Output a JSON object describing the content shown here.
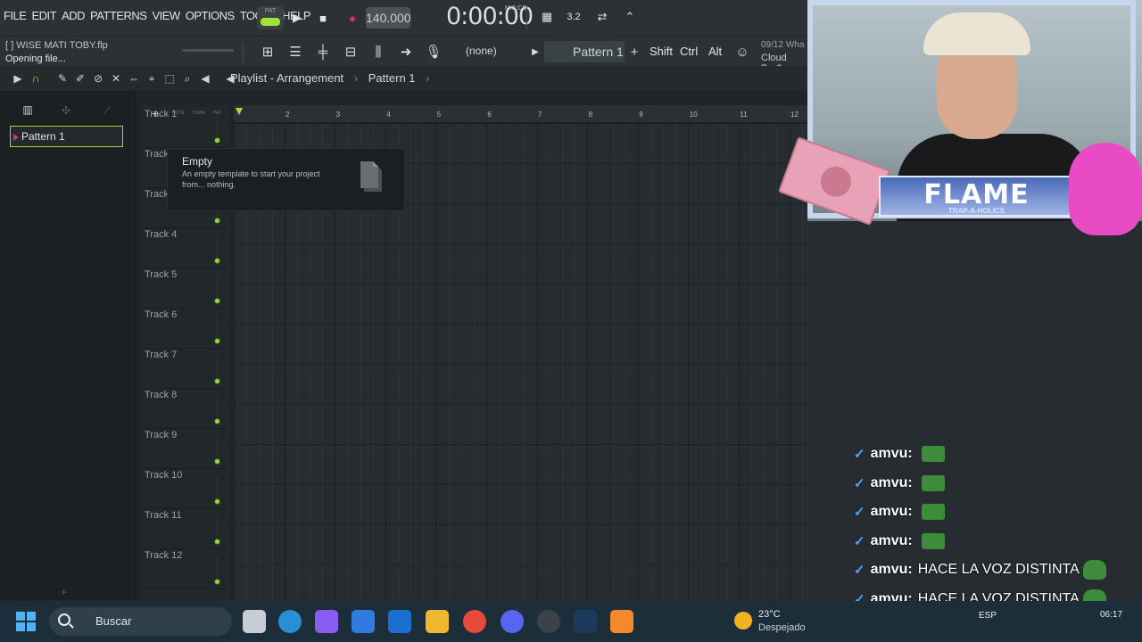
{
  "menu": [
    "FILE",
    "EDIT",
    "ADD",
    "PATTERNS",
    "VIEW",
    "OPTIONS",
    "TOOLS",
    "HELP"
  ],
  "transport": {
    "mode_label": "PAT",
    "tempo": "140.000",
    "time": "0:00:00",
    "time_unit": "M:S:CS"
  },
  "project": {
    "filename": "[ ] WISE MATI TOBY.flp",
    "status": "Opening file..."
  },
  "toolbar2": {
    "input_select": "(none)",
    "pattern_select": "Pattern 1",
    "keys": [
      "Shift",
      "Ctrl",
      "Alt"
    ],
    "date": "09/12",
    "date_suffix": "Wha",
    "cloud": "Cloud Pro?"
  },
  "playlist": {
    "breadcrumb": [
      "Playlist - Arrangement",
      "Pattern 1"
    ],
    "header_labels": [
      "NOTE",
      "CHAN",
      "PAT"
    ],
    "bars": [
      "2",
      "3",
      "4",
      "5",
      "6",
      "7",
      "8",
      "9",
      "10",
      "11",
      "12"
    ],
    "tracks": [
      "Track 1",
      "Track 2",
      "Track 3",
      "Track 4",
      "Track 5",
      "Track 6",
      "Track 7",
      "Track 8",
      "Track 9",
      "Track 10",
      "Track 11",
      "Track 12"
    ]
  },
  "picker": {
    "pattern_item": "Pattern 1"
  },
  "popup": {
    "title": "Empty",
    "description": "An empty template to start your project from... nothing."
  },
  "overlay": {
    "banner_title": "FLAME",
    "banner_sub": "TRAP-A-HOLICS"
  },
  "chat": [
    {
      "user": "amvu:",
      "message": ""
    },
    {
      "user": "amvu:",
      "message": ""
    },
    {
      "user": "amvu:",
      "message": ""
    },
    {
      "user": "amvu:",
      "message": ""
    },
    {
      "user": "amvu:",
      "message": "HACE LA VOZ DISTINTA"
    },
    {
      "user": "amvu:",
      "message": "HACE LA VOZ DISTINTA"
    },
    {
      "user": "amvu:",
      "message": "HACE LA VOZ DISTINTA"
    }
  ],
  "taskbar": {
    "search_placeholder": "Buscar",
    "weather_temp": "23°C",
    "weather_desc": "Despejado",
    "language": "ESP",
    "time": "06:17"
  },
  "colors": {
    "accent_green": "#9fe23a",
    "record_red": "#e0344c",
    "chat_badge_blue": "#4aa3ff"
  }
}
